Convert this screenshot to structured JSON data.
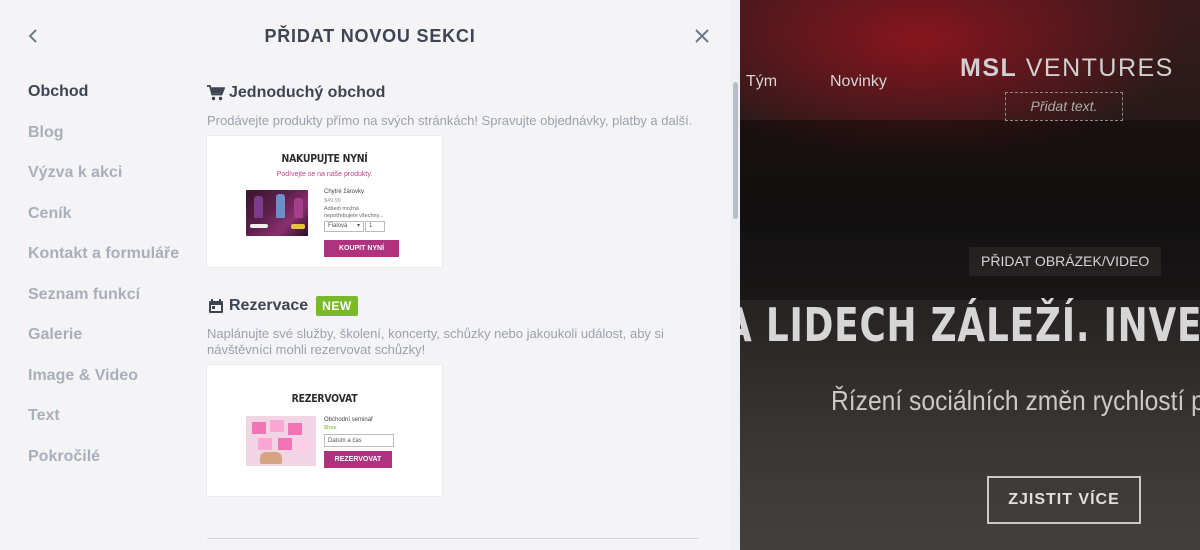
{
  "panel": {
    "title": "PŘIDAT NOVOU SEKCI",
    "back_icon": "chevron-left-icon",
    "close_icon": "close-icon"
  },
  "categories": [
    {
      "label": "Obchod",
      "active": true
    },
    {
      "label": "Blog",
      "active": false
    },
    {
      "label": "Výzva k akci",
      "active": false
    },
    {
      "label": "Ceník",
      "active": false
    },
    {
      "label": "Kontakt a formuláře",
      "active": false
    },
    {
      "label": "Seznam funkcí",
      "active": false
    },
    {
      "label": "Galerie",
      "active": false
    },
    {
      "label": "Image & Video",
      "active": false
    },
    {
      "label": "Text",
      "active": false
    },
    {
      "label": "Pokročilé",
      "active": false
    }
  ],
  "sections": {
    "shop": {
      "icon": "cart-icon",
      "title": "Jednoduchý obchod",
      "description": "Prodávejte produkty přímo na svých stránkách! Spravujte objednávky, platby a další.",
      "thumb": {
        "heading": "NAKUPUJTE NYNÍ",
        "subheading": "Podívejte se na naše produkty.",
        "product_name": "Chytré žárovky",
        "price": "$49.99",
        "product_desc": "Adšedi možná",
        "product_desc2": "nepotřebujete všechny...",
        "variant": "Fialová",
        "qty": "1",
        "button": "KOUPIT NYNÍ"
      }
    },
    "booking": {
      "icon": "calendar-icon",
      "title": "Rezervace",
      "badge": "NEW",
      "description": "Naplánujte své služby, školení, koncerty, schůzky nebo jakoukoli událost, aby si návštěvníci mohli rezervovat schůzky!",
      "thumb": {
        "heading": "REZERVOVAT",
        "service": "Obchodní seminář",
        "price": "$free",
        "date_placeholder": "Datum a čas",
        "button": "REZERVOVAT"
      }
    }
  },
  "preview": {
    "nav": [
      "Tým",
      "Novinky"
    ],
    "logo_bold": "MSL",
    "logo_rest": " VENTURES",
    "add_text": "Přidat text.",
    "add_media": "PŘIDAT OBRÁZEK/VIDEO",
    "headline": "A LIDECH ZÁLEŽÍ. INVESTUJ",
    "subline": "Řízení sociálních změn rychlostí p",
    "cta": "ZJISTIT VÍCE"
  },
  "colors": {
    "accent": "#b0317d",
    "badge_green": "#7ab92a",
    "text_dark": "#3d4453",
    "text_muted": "#a9afba"
  }
}
